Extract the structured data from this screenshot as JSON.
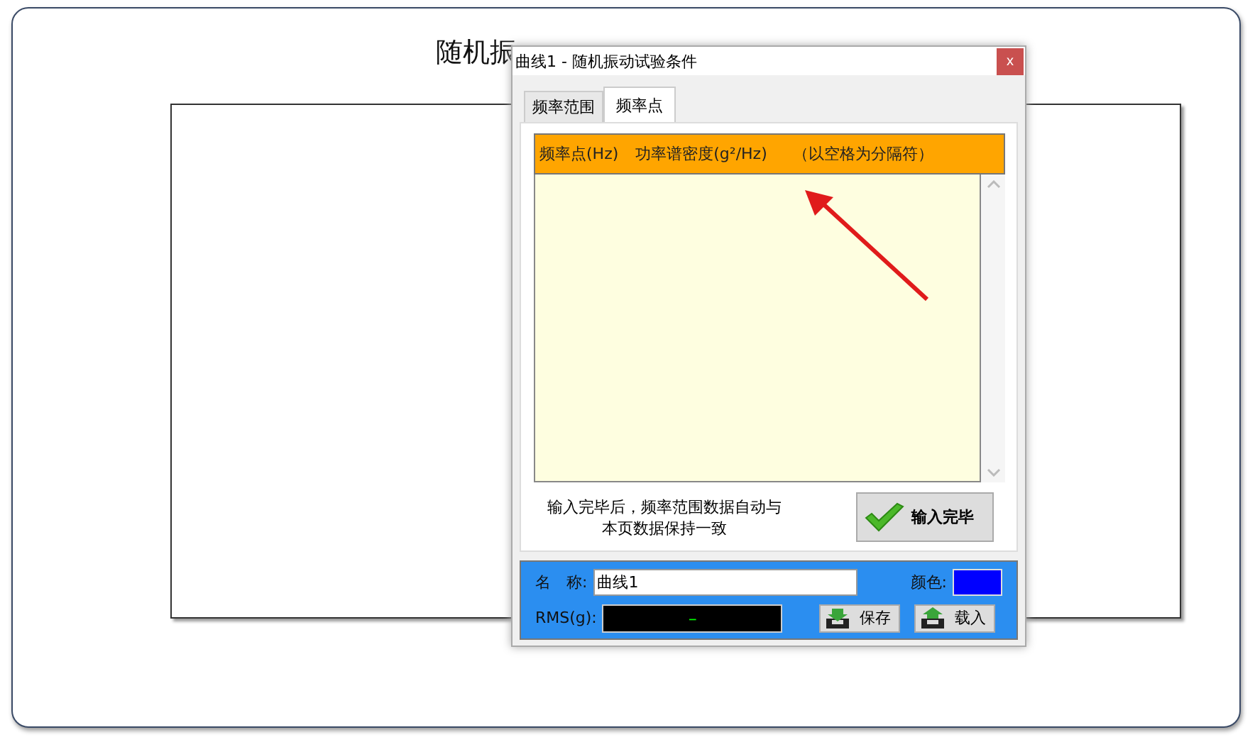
{
  "main": {
    "title": "随机振"
  },
  "dialog": {
    "title": "曲线1 - 随机振动试验条件",
    "close": "x",
    "tabs": [
      {
        "label": "频率范围",
        "selected": false
      },
      {
        "label": "频率点",
        "selected": true
      }
    ],
    "table_header": [
      "频率点(Hz)",
      "功率谱密度(g²/Hz)",
      "（以空格为分隔符）"
    ],
    "note": "输入完毕后，频率范围数据自动与本页数据保持一致",
    "done_button": "输入完毕",
    "name_label": "名　称:",
    "name_value": "曲线1",
    "color_label": "颜色:",
    "color": "#0000ff",
    "rms_label": "RMS(g):",
    "rms_value": "–",
    "buttons": [
      {
        "label": "保存",
        "kind": "save"
      },
      {
        "label": "载入",
        "kind": "load"
      }
    ]
  }
}
